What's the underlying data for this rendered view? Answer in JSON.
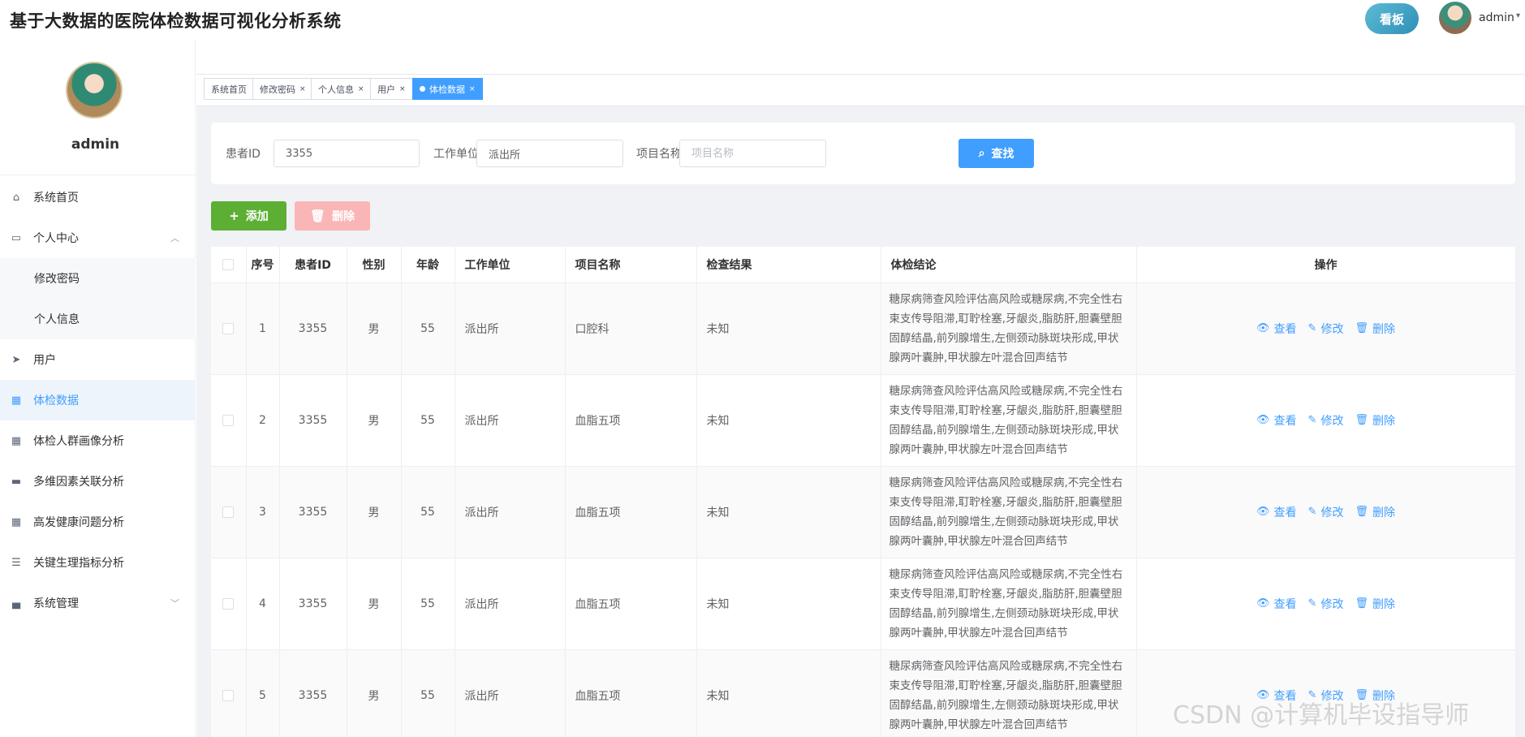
{
  "app": {
    "title": "基于大数据的医院体检数据可视化分析系统"
  },
  "header": {
    "board_label": "看板",
    "username": "admin",
    "caret": "▾"
  },
  "sidebar": {
    "username": "admin",
    "items": [
      {
        "label": "系统首页",
        "icon": "home-icon",
        "glyph": "⌂"
      },
      {
        "label": "个人中心",
        "icon": "wallet-icon",
        "glyph": "▭",
        "caret": "︿"
      },
      {
        "label": "修改密码",
        "sub": true
      },
      {
        "label": "个人信息",
        "sub": true
      },
      {
        "label": "用户",
        "icon": "send-icon",
        "glyph": "➤"
      },
      {
        "label": "体检数据",
        "icon": "grid-icon",
        "glyph": "▦",
        "active": true
      },
      {
        "label": "体检人群画像分析",
        "icon": "grid-icon",
        "glyph": "▦"
      },
      {
        "label": "多维因素关联分析",
        "icon": "chat-icon",
        "glyph": "▬"
      },
      {
        "label": "高发健康问题分析",
        "icon": "grid-icon",
        "glyph": "▦"
      },
      {
        "label": "关键生理指标分析",
        "icon": "list-icon",
        "glyph": "☰"
      },
      {
        "label": "系统管理",
        "icon": "box-icon",
        "glyph": "▄",
        "caret": "﹀"
      }
    ]
  },
  "tabs": [
    {
      "label": "系统首页"
    },
    {
      "label": "修改密码",
      "close": "×"
    },
    {
      "label": "个人信息",
      "close": "×"
    },
    {
      "label": "用户",
      "close": "×"
    },
    {
      "label": "体检数据",
      "close": "×",
      "active": true
    }
  ],
  "search": {
    "patient_id_label": "患者ID",
    "patient_id_value": "3355",
    "work_unit_label": "工作单位",
    "work_unit_value": "派出所",
    "item_name_label": "项目名称",
    "item_name_placeholder": "项目名称",
    "search_button": "查找"
  },
  "actions": {
    "add": "添加",
    "delete": "删除"
  },
  "table": {
    "headers": [
      "序号",
      "患者ID",
      "性别",
      "年龄",
      "工作单位",
      "项目名称",
      "检查结果",
      "体检结论",
      "操作"
    ],
    "ops": {
      "view": "查看",
      "edit": "修改",
      "delete": "删除"
    },
    "rows": [
      {
        "no": "1",
        "pid": "3355",
        "gender": "男",
        "age": "55",
        "unit": "派出所",
        "item": "口腔科",
        "result": "未知",
        "conclusion": "糖尿病筛查风险评估高风险或糖尿病,不完全性右束支传导阻滞,耵聍栓塞,牙龈炎,脂肪肝,胆囊壁胆固醇结晶,前列腺增生,左侧颈动脉斑块形成,甲状腺两叶囊肿,甲状腺左叶混合回声结节"
      },
      {
        "no": "2",
        "pid": "3355",
        "gender": "男",
        "age": "55",
        "unit": "派出所",
        "item": "血脂五项",
        "result": "未知",
        "conclusion": "糖尿病筛查风险评估高风险或糖尿病,不完全性右束支传导阻滞,耵聍栓塞,牙龈炎,脂肪肝,胆囊壁胆固醇结晶,前列腺增生,左侧颈动脉斑块形成,甲状腺两叶囊肿,甲状腺左叶混合回声结节"
      },
      {
        "no": "3",
        "pid": "3355",
        "gender": "男",
        "age": "55",
        "unit": "派出所",
        "item": "血脂五项",
        "result": "未知",
        "conclusion": "糖尿病筛查风险评估高风险或糖尿病,不完全性右束支传导阻滞,耵聍栓塞,牙龈炎,脂肪肝,胆囊壁胆固醇结晶,前列腺增生,左侧颈动脉斑块形成,甲状腺两叶囊肿,甲状腺左叶混合回声结节"
      },
      {
        "no": "4",
        "pid": "3355",
        "gender": "男",
        "age": "55",
        "unit": "派出所",
        "item": "血脂五项",
        "result": "未知",
        "conclusion": "糖尿病筛查风险评估高风险或糖尿病,不完全性右束支传导阻滞,耵聍栓塞,牙龈炎,脂肪肝,胆囊壁胆固醇结晶,前列腺增生,左侧颈动脉斑块形成,甲状腺两叶囊肿,甲状腺左叶混合回声结节"
      },
      {
        "no": "5",
        "pid": "3355",
        "gender": "男",
        "age": "55",
        "unit": "派出所",
        "item": "血脂五项",
        "result": "未知",
        "conclusion": "糖尿病筛查风险评估高风险或糖尿病,不完全性右束支传导阻滞,耵聍栓塞,牙龈炎,脂肪肝,胆囊壁胆固醇结晶,前列腺增生,左侧颈动脉斑块形成,甲状腺两叶囊肿,甲状腺左叶混合回声结节"
      }
    ]
  },
  "watermark": "CSDN @计算机毕设指导师",
  "colors": {
    "primary": "#409eff",
    "success": "#5daf34",
    "danger_disabled": "#fab6b6"
  }
}
